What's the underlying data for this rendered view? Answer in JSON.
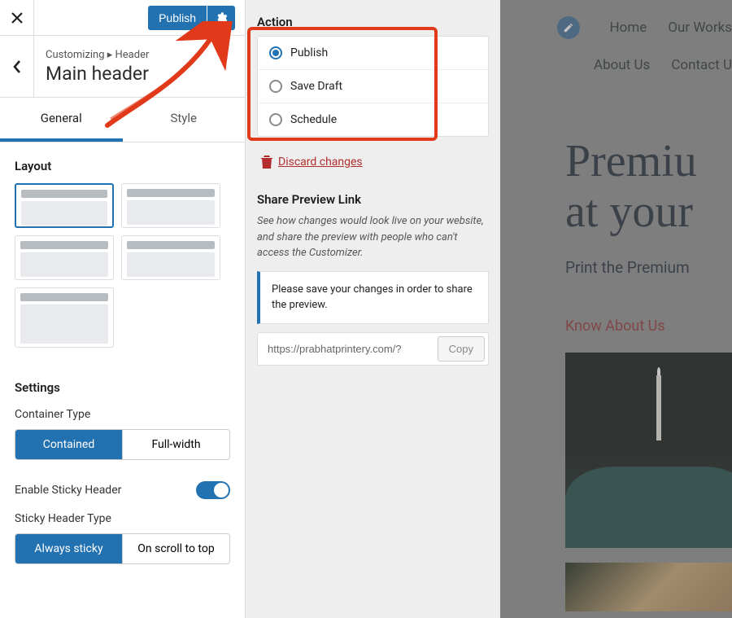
{
  "topbar": {
    "publish": "Publish"
  },
  "header": {
    "breadcrumb": "Customizing ▸ Header",
    "title": "Main header"
  },
  "tabs": {
    "general": "General",
    "style": "Style"
  },
  "layout": {
    "heading": "Layout"
  },
  "settings": {
    "heading": "Settings",
    "container_type_label": "Container Type",
    "contained": "Contained",
    "full_width": "Full-width",
    "enable_sticky": "Enable Sticky Header",
    "sticky_type_label": "Sticky Header Type",
    "always_sticky": "Always sticky",
    "on_scroll": "On scroll to top"
  },
  "popover": {
    "action_heading": "Action",
    "publish": "Publish",
    "save_draft": "Save Draft",
    "schedule": "Schedule",
    "discard": "Discard changes",
    "share_heading": "Share Preview Link",
    "share_desc": "See how changes would look live on your website, and share the preview with people who can't access the Customizer.",
    "notice": "Please save your changes in order to share the preview.",
    "url": "https://prabhatprintery.com/?",
    "copy": "Copy"
  },
  "preview": {
    "nav": {
      "home": "Home",
      "works": "Our Works",
      "about": "About Us",
      "contact": "Contact U"
    },
    "hero1": "Premiu",
    "hero2": "at your",
    "sub": "Print the Premium",
    "know": "Know About Us"
  }
}
